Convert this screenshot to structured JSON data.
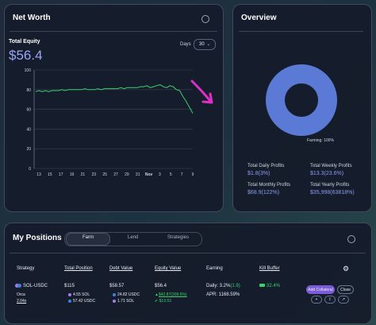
{
  "net_worth": {
    "title": "Net Worth",
    "total_equity_label": "Total Equity",
    "total_equity_value": "$56.4",
    "days_label": "Days",
    "days_value": "30",
    "chart_data": {
      "type": "line",
      "title": "",
      "xlabel": "",
      "ylabel": "",
      "ylim": [
        0,
        100
      ],
      "y_ticks": [
        "100",
        "80",
        "60",
        "40",
        "20",
        "0"
      ],
      "x_ticks": [
        "13",
        "15",
        "17",
        "19",
        "21",
        "23",
        "25",
        "27",
        "29",
        "31",
        "Nov",
        "3",
        "5",
        "7",
        "9"
      ],
      "series": [
        {
          "values": [
            78,
            79,
            78,
            79,
            78,
            79,
            79,
            79,
            80,
            79,
            80,
            80,
            80,
            80,
            80,
            81,
            80,
            80,
            80,
            81,
            80,
            81,
            81,
            81,
            81,
            81,
            82,
            81,
            82,
            82,
            82,
            82,
            83,
            83,
            84,
            82,
            83,
            84,
            85,
            83,
            82,
            84,
            83,
            80,
            79,
            73,
            68,
            62,
            56
          ]
        }
      ],
      "line_color": "#3ad16b",
      "grid": true
    }
  },
  "overview": {
    "title": "Overview",
    "donut_label": "Farming: 100%",
    "chart_data": {
      "type": "pie",
      "categories": [
        "Farming"
      ],
      "values": [
        100
      ]
    },
    "donut_color": "#5b7ad6",
    "stats": [
      {
        "label": "Total Daily Profits",
        "value": "$1.8(3%)"
      },
      {
        "label": "Total Weekly Profits",
        "value": "$13.3(23.6%)"
      },
      {
        "label": "Total Monthly Profits",
        "value": "$68.9(122%)"
      },
      {
        "label": "Total Yearly Profits",
        "value": "$35,998(63818%)"
      }
    ]
  },
  "positions": {
    "title": "My Positions",
    "tabs": [
      "Farm",
      "Lend",
      "Strategies"
    ],
    "columns": [
      "Strategy",
      "Total Position",
      "Debt Value",
      "Equity Value",
      "Earning",
      "Kill Buffer"
    ],
    "row": {
      "pair": "SOL-USDC",
      "protocol": "Orca",
      "leverage": "2.04x",
      "total_position": "$115",
      "total_position_sub1": "4.55 SOL",
      "total_position_sub2": "57.42 USDC",
      "debt_value": "$58.57",
      "debt_sub1": "24.82 USDC",
      "debt_sub2": "1.71 SOL",
      "equity_value": "$56.4",
      "equity_change": "$42.87(309.6%)",
      "equity_change2": "$13.53",
      "earning_daily": "Daily: 3.2%",
      "earning_daily_extra": "(1.9)",
      "earning_apr": "APR: 1168.59%",
      "kill_buffer": "32.4%",
      "add_collateral": "Add Collateral",
      "close": "Close"
    }
  }
}
